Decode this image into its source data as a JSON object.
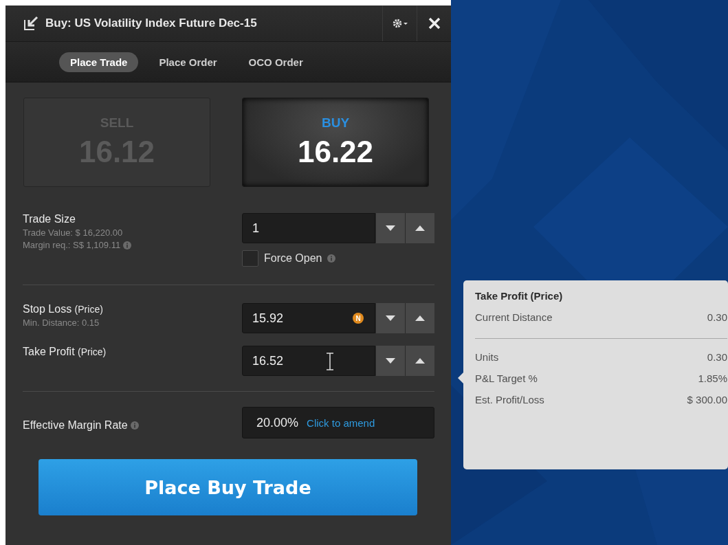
{
  "window": {
    "title": "Buy: US Volatility Index Future Dec-15"
  },
  "tabs": [
    {
      "label": "Place Trade",
      "selected": true
    },
    {
      "label": "Place Order",
      "selected": false
    },
    {
      "label": "OCO Order",
      "selected": false
    }
  ],
  "sides": [
    {
      "label": "SELL",
      "price": "16.12",
      "selected": false
    },
    {
      "label": "BUY",
      "price": "16.22",
      "selected": true
    }
  ],
  "trade_size": {
    "label": "Trade Size",
    "notes": [
      "Trade Value: $ 16,220.00",
      "Margin req.: S$ 1,109.11"
    ],
    "value": "1",
    "force_open": {
      "label": "Force Open",
      "checked": false
    }
  },
  "stop_loss": {
    "label": "Stop Loss",
    "suffix": "(Price)",
    "note": "Min. Distance: 0.15",
    "value": "15.92",
    "badge": "N"
  },
  "take_profit": {
    "label": "Take Profit",
    "suffix": "(Price)",
    "value": "16.52"
  },
  "margin_rate": {
    "label": "Effective Margin Rate",
    "value": "20.00%",
    "link": "Click to amend"
  },
  "submit": {
    "label": "Place Buy Trade"
  },
  "tooltip": {
    "title": "Take Profit (Price)",
    "sections": [
      [
        {
          "label": "Current Distance",
          "value": "0.30"
        }
      ],
      [
        {
          "label": "Units",
          "value": "0.30"
        },
        {
          "label": "P&L Target %",
          "value": "1.85%"
        },
        {
          "label": "Est. Profit/Loss",
          "value": "$ 300.00"
        }
      ]
    ]
  }
}
